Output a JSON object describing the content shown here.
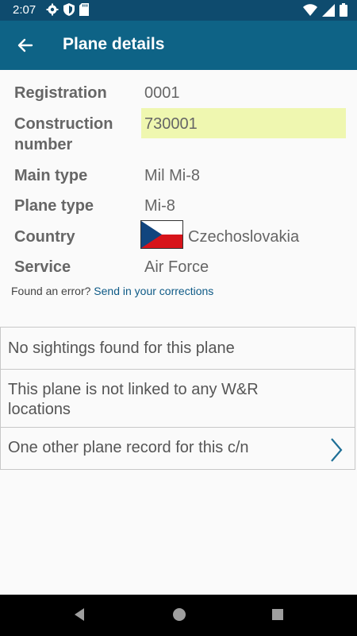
{
  "status": {
    "time": "2:07",
    "icons": [
      "settings-icon",
      "shield-icon",
      "sd-card-icon",
      "wifi-icon",
      "signal-icon",
      "battery-icon"
    ]
  },
  "app_bar": {
    "title": "Plane details",
    "back_icon": "back-arrow-icon",
    "color": "#0e6386"
  },
  "details": {
    "registration": {
      "label": "Registration",
      "value": "0001"
    },
    "construction_number": {
      "label_line1": "Construction",
      "label_line2": "number",
      "value": "730001"
    },
    "main_type": {
      "label": "Main type",
      "value": "Mil Mi-8"
    },
    "plane_type": {
      "label": "Plane type",
      "value": "Mi-8"
    },
    "country": {
      "label": "Country",
      "value": "Czechoslovakia",
      "flag_icon": "czech-flag-icon"
    },
    "service": {
      "label": "Service",
      "value": "Air Force"
    }
  },
  "error_prompt": {
    "text": "Found an error?",
    "link": "Send in your corrections"
  },
  "cards": {
    "sightings": "No sightings found for this plane",
    "wr_line1": "This plane is not linked to any W&R",
    "wr_line2": "locations",
    "other_records": "One other plane record for this c/n"
  },
  "navigation": [
    "back-icon",
    "home-icon",
    "recents-icon"
  ]
}
